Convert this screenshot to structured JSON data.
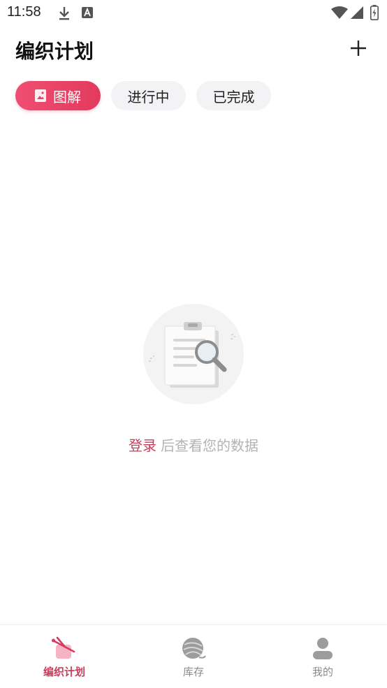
{
  "status_bar": {
    "time": "11:58",
    "icons": [
      "download-icon",
      "text-a-icon",
      "wifi-icon",
      "signal-icon",
      "battery-icon"
    ]
  },
  "header": {
    "title": "编织计划",
    "add_icon": "plus-icon"
  },
  "tabs": [
    {
      "label": "图解",
      "icon": "image-icon",
      "active": true
    },
    {
      "label": "进行中",
      "active": false
    },
    {
      "label": "已完成",
      "active": false
    }
  ],
  "empty_state": {
    "illustration": "clipboard-search-icon",
    "login_link": "登录",
    "message": "后查看您的数据"
  },
  "bottom_nav": [
    {
      "label": "编织计划",
      "icon": "knitting-icon",
      "active": true
    },
    {
      "label": "库存",
      "icon": "yarn-ball-icon",
      "active": false
    },
    {
      "label": "我的",
      "icon": "person-icon",
      "active": false
    }
  ],
  "colors": {
    "accent": "#e23a5d",
    "accent_text": "#c73e5d",
    "tab_bg": "#f3f3f5",
    "muted_text": "#b3b3b3"
  }
}
